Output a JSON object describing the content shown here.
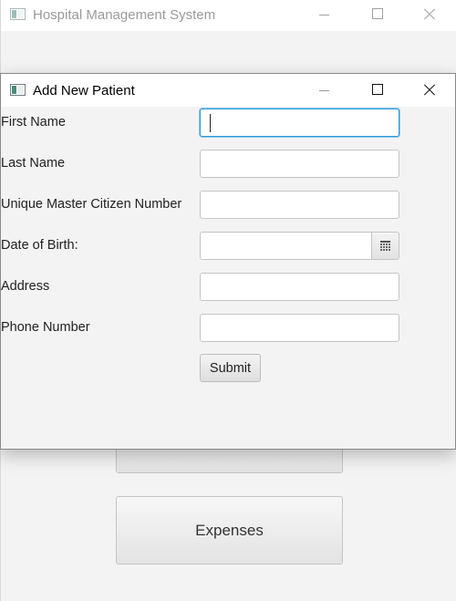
{
  "main_window": {
    "title": "Hospital Management System",
    "buttons": {
      "expenses_label": "Expenses"
    }
  },
  "dialog": {
    "title": "Add New Patient",
    "fields": [
      {
        "label": "First Name",
        "value": ""
      },
      {
        "label": "Last Name",
        "value": ""
      },
      {
        "label": "Unique Master Citizen Number",
        "value": ""
      },
      {
        "label": "Date of Birth:",
        "value": ""
      },
      {
        "label": "Address",
        "value": ""
      },
      {
        "label": "Phone Number",
        "value": ""
      }
    ],
    "submit_label": "Submit",
    "calendar_icon": "calendar-icon"
  },
  "colors": {
    "focus_border": "#2d9bd9",
    "background": "#f3f3f3"
  }
}
